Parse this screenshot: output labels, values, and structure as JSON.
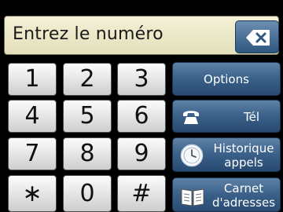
{
  "entry": {
    "placeholder_text": "Entrez le numéro",
    "backspace_icon": "backspace-icon"
  },
  "keypad": {
    "keys": [
      "1",
      "2",
      "3",
      "4",
      "5",
      "6",
      "7",
      "8",
      "9",
      "∗",
      "0",
      "#"
    ]
  },
  "actions": {
    "options_label": "Options",
    "tel_label": "Tél",
    "history_label_line1": "Historique",
    "history_label_line2": "appels",
    "addressbook_label_line1": "Carnet",
    "addressbook_label_line2": "d'adresses"
  },
  "colors": {
    "field_bg": "#eeeacb",
    "action_blue": "#3a6089",
    "key_bg": "#e8e8e8"
  }
}
